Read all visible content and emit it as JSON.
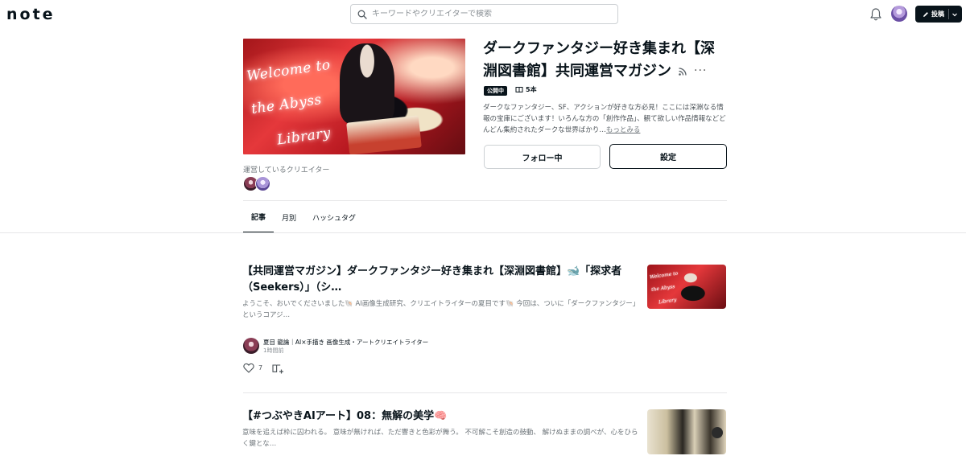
{
  "header": {
    "logo": "note",
    "search_placeholder": "キーワードやクリエイターで検索",
    "post_button": "投稿"
  },
  "magazine": {
    "cover_lines": [
      "Welcome to",
      "the Abyss",
      "Library"
    ],
    "title": "ダークファンタジー好き集まれ【深淵図書館】共同運営マガジン",
    "status_badge": "公開中",
    "article_count": "5本",
    "description": "ダークなファンタジー、SF、アクションが好きな方必見！ここには深淵なる情報の宝庫にございます！いろんな方の「創作作品」、観て欲しい作品情報などどんどん集約されたダークな世界ばかり…",
    "more_link": "もっとみる",
    "follow_button": "フォロー中",
    "settings_button": "設定",
    "creators_label": "運営しているクリエイター"
  },
  "tabs": [
    {
      "label": "記事",
      "active": true
    },
    {
      "label": "月別",
      "active": false
    },
    {
      "label": "ハッシュタグ",
      "active": false
    }
  ],
  "articles": [
    {
      "title": "【共同運営マガジン】ダークファンタジー好き集まれ【深淵図書館】🐋「探求者（Seekers）」（シ…",
      "excerpt": "ようこそ、おいでくださいました🐚 AI画像生成研究、クリエイトライターの夏目です🐚 今回は、ついに「ダークファンタジー」というコアジ…",
      "author": "夏目 龍論｜AI×手描き 画像生成・アートクリエイトライター",
      "time": "1時間前",
      "likes": "7",
      "thumb_lines": [
        "Welcome to",
        "the Abyss",
        "Library"
      ]
    },
    {
      "title": "【#つぶやきAIアート】08：無解の美学🧠",
      "excerpt": "意味を追えば枠に囚われる。 意味が無ければ、ただ響きと色彩が舞う。 不可解こそ創造の鼓動、 解けぬままの調べが、心をひらく鍵とな…"
    }
  ],
  "colors": {
    "text": "#08131a",
    "muted": "#6d7479",
    "border": "#e6e7e8",
    "primary_dark": "#08131a"
  }
}
